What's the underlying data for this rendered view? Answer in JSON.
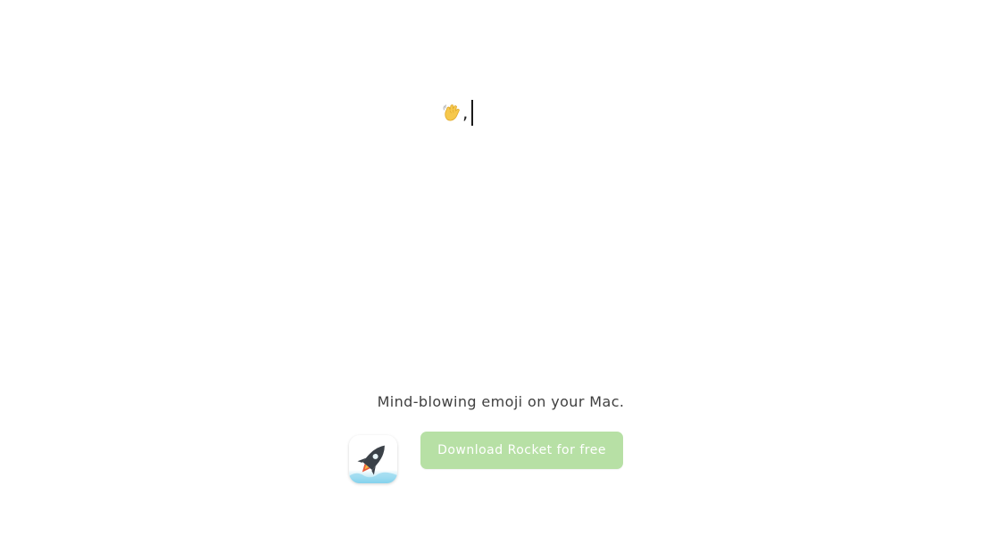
{
  "typing": {
    "emoji_icon": "waving-hand-icon",
    "text": ","
  },
  "tagline": "Mind-blowing emoji on your Mac.",
  "app": {
    "icon": "rocket-app-icon"
  },
  "cta": {
    "label": "Download Rocket for free",
    "color": "#b7e0a5"
  }
}
